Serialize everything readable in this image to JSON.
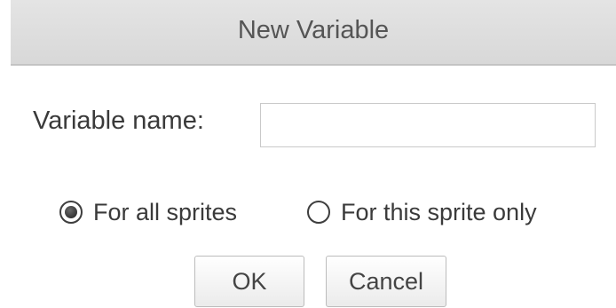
{
  "dialog": {
    "title": "New Variable",
    "name_field": {
      "label": "Variable name:",
      "value": "",
      "placeholder": ""
    },
    "scope_options": [
      {
        "label": "For all sprites",
        "selected": true
      },
      {
        "label": "For this sprite only",
        "selected": false
      }
    ],
    "buttons": {
      "ok_label": "OK",
      "cancel_label": "Cancel"
    }
  }
}
